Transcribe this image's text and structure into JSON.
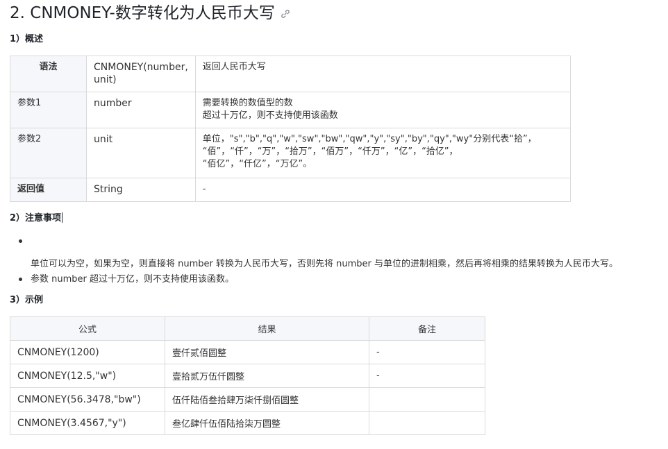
{
  "title": "2. CNMONEY-数字转化为人民币大写",
  "sections": {
    "overview": "1）概述",
    "notes": "2）注意事项",
    "example": "3）示例"
  },
  "syntax_table": {
    "rows": [
      {
        "label": "语法",
        "value": "CNMONEY(number, unit)",
        "value_lines": [
          "CNMONEY(number,",
          "unit)"
        ],
        "desc_lines": [
          "返回人民币大写"
        ]
      },
      {
        "label": "参数1",
        "value": "number",
        "desc_lines": [
          "需要转换的数值型的数",
          "超过十万亿，则不支持使用该函数"
        ]
      },
      {
        "label": "参数2",
        "value": "unit",
        "desc_lines": [
          "单位，\"s\",\"b\",\"q\",\"w\",\"sw\",\"bw\",\"qw\",\"y\",\"sy\",\"by\",\"qy\",\"wy\"分别代表“拾”，",
          "“佰”，“仟”，“万”，“拾万”，“佰万”，“仟万”，“亿”，“拾亿”，",
          "“佰亿”，“仟亿”，“万亿”。"
        ]
      },
      {
        "label": "返回值",
        "value": "String",
        "desc_lines": [
          "-"
        ]
      }
    ]
  },
  "notes": [
    "单位可以为空，如果为空，则直接将 number 转换为人民币大写，否则先将 number 与单位的进制相乘，然后再将相乘的结果转换为人民币大写。",
    "参数 number 超过十万亿，则不支持使用该函数。"
  ],
  "example_table": {
    "headers": [
      "公式",
      "结果",
      "备注"
    ],
    "rows": [
      [
        "CNMONEY(1200)",
        "壹仟贰佰圆整",
        "-"
      ],
      [
        "CNMONEY(12.5,\"w\")",
        "壹拾贰万伍仟圆整",
        "-"
      ],
      [
        "CNMONEY(56.3478,\"bw\")",
        "伍仟陆佰叁拾肆万柒仟捌佰圆整",
        ""
      ],
      [
        "CNMONEY(3.4567,\"y\")",
        "叁亿肆仟伍佰陆拾柒万圆整",
        ""
      ]
    ]
  },
  "colors": {
    "border": "#d9d9d9",
    "header_bg": "#f5f7fa",
    "text": "#333333",
    "link_icon": "#8a8f99"
  },
  "icons": {
    "title_anchor": "link-icon"
  }
}
